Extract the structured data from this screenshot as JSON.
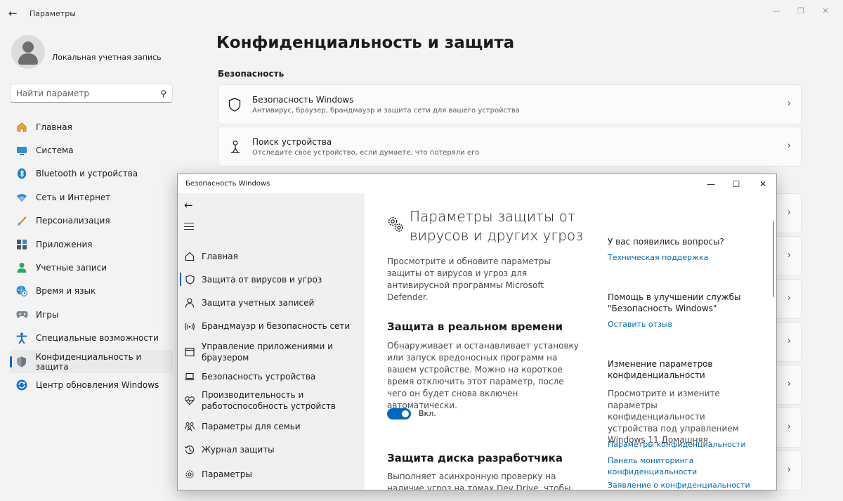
{
  "settings": {
    "window_title": "Параметры",
    "account_name": "Локальная учетная запись",
    "search_placeholder": "Найти параметр",
    "nav": [
      {
        "label": "Главная",
        "icon": "home-icon"
      },
      {
        "label": "Система",
        "icon": "system-icon"
      },
      {
        "label": "Bluetooth и устройства",
        "icon": "bluetooth-icon"
      },
      {
        "label": "Сеть и Интернет",
        "icon": "network-icon"
      },
      {
        "label": "Персонализация",
        "icon": "brush-icon"
      },
      {
        "label": "Приложения",
        "icon": "apps-icon"
      },
      {
        "label": "Учетные записи",
        "icon": "accounts-icon"
      },
      {
        "label": "Время и язык",
        "icon": "globe-clock-icon"
      },
      {
        "label": "Игры",
        "icon": "gamepad-icon"
      },
      {
        "label": "Специальные возможности",
        "icon": "accessibility-icon"
      },
      {
        "label": "Конфиденциальность и защита",
        "icon": "shield-icon"
      },
      {
        "label": "Центр обновления Windows",
        "icon": "update-icon"
      }
    ],
    "page_title": "Конфиденциальность и защита",
    "section_title": "Безопасность",
    "cards": [
      {
        "title": "Безопасность Windows",
        "subtitle": "Антивирус, браузер, брандмауэр и защита сети для вашего устройства",
        "icon": "shield-icon"
      },
      {
        "title": "Поиск устройства",
        "subtitle": "Отследите свое устройство, если думаете, что потеряли его",
        "icon": "person-pin-icon"
      }
    ]
  },
  "security": {
    "window_title": "Безопасность Windows",
    "nav": [
      {
        "label": "Главная",
        "icon": "home-icon"
      },
      {
        "label": "Защита от вирусов и угроз",
        "icon": "shield-icon"
      },
      {
        "label": "Защита учетных записей",
        "icon": "person-icon"
      },
      {
        "label": "Брандмауэр и безопасность сети",
        "icon": "wifi-icon"
      },
      {
        "label": "Управление приложениями и браузером",
        "icon": "app-window-icon"
      },
      {
        "label": "Безопасность устройства",
        "icon": "laptop-icon"
      },
      {
        "label": "Производительность и работоспособность устройств",
        "icon": "heart-pulse-icon"
      },
      {
        "label": "Параметры для семьи",
        "icon": "family-icon"
      },
      {
        "label": "Журнал защиты",
        "icon": "history-icon"
      }
    ],
    "settings_label": "Параметры",
    "heading": "Параметры защиты от вирусов и других угроз",
    "description": "Просмотрите и обновите параметры защиты от вирусов и угроз для антивирусной программы Microsoft Defender.",
    "realtime_title": "Защита в реальном времени",
    "realtime_text": "Обнаруживает и останавливает установку или запуск вредоносных программ на вашем устройстве. Можно на короткое время отключить этот параметр, после чего он будет снова включен автоматически.",
    "toggle_label": "Вкл.",
    "toggle_on": true,
    "devdrive_title": "Защита диска разработчика",
    "devdrive_text": "Выполняет асинхронную проверку на наличие угроз на томах Dev Drive, чтобы снизить",
    "questions_title": "У вас появились вопросы?",
    "support_link": "Техническая поддержка",
    "improve_title": "Помощь в улучшении службы \"Безопасность Windows\"",
    "feedback_link": "Оставить отзыв",
    "privacy_title": "Изменение параметров конфиденциальности",
    "privacy_text": "Просмотрите и измените параметры конфиденциальности устройства под управлением Windows 11 Домашняя.",
    "privacy_links": [
      "Параметры конфиденциальности",
      "Панель мониторинга конфиденциальности",
      "Заявление о конфиденциальности"
    ]
  },
  "colors": {
    "accent": "#0067c0",
    "link": "#0067b8"
  }
}
